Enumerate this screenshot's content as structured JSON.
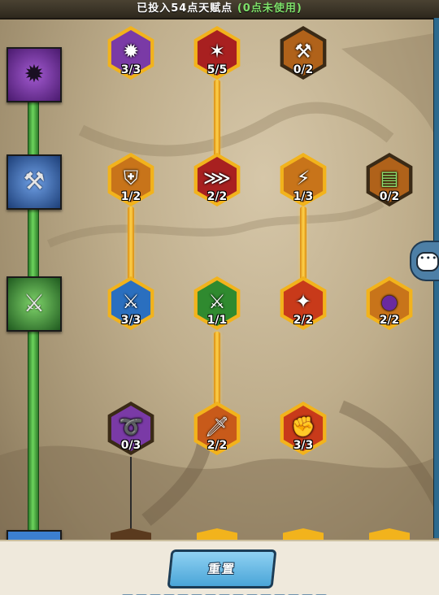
{
  "header": {
    "points_text": "已投入54点天赋点",
    "unused_text": "(0点未使用)"
  },
  "colors": {
    "gold": "#f2b31c",
    "rail_green": "#4fbf3f",
    "button_blue": "#5fb6e4"
  },
  "rows": [
    {
      "icon": "spiked-ball-icon",
      "bg": "#6a2a8f"
    },
    {
      "icon": "axe-icon",
      "bg": "#1f5aa0"
    },
    {
      "icon": "battle-axe-icon",
      "bg": "#2a7a2a"
    },
    {
      "icon": "sword-icon",
      "bg": "#1f5aa0"
    }
  ],
  "nodes": [
    {
      "id": "spiked-ball",
      "level": "3/3",
      "glyph": "✹",
      "inner": "#7a3aa6"
    },
    {
      "id": "blood-claw",
      "level": "5/5",
      "glyph": "✶",
      "inner": "#a82020"
    },
    {
      "id": "hammer",
      "level": "0/2",
      "glyph": "⚒",
      "inner": "#b0621a"
    },
    {
      "id": "helmet",
      "level": "1/2",
      "glyph": "⛨",
      "inner": "#c8741a"
    },
    {
      "id": "claw-slash",
      "level": "2/2",
      "glyph": "⋙",
      "inner": "#a82020"
    },
    {
      "id": "lightning-blade",
      "level": "1/3",
      "glyph": "⚡",
      "inner": "#c8741a"
    },
    {
      "id": "green-book",
      "level": "0/2",
      "glyph": "▤",
      "inner": "#b0621a"
    },
    {
      "id": "ice-axe",
      "level": "3/3",
      "glyph": "⚔",
      "inner": "#2a6fbf"
    },
    {
      "id": "green-axe",
      "level": "1/1",
      "glyph": "⚔",
      "inner": "#2f8a2f"
    },
    {
      "id": "fire-blade",
      "level": "2/2",
      "glyph": "✦",
      "inner": "#c83a1a"
    },
    {
      "id": "purple-orb",
      "level": "2/2",
      "glyph": "●",
      "inner": "#c8741a"
    },
    {
      "id": "purple-whip",
      "level": "0/3",
      "glyph": "➰",
      "inner": "#7a3aa6"
    },
    {
      "id": "golden-sword",
      "level": "2/2",
      "glyph": "🗡",
      "inner": "#c85a1a"
    },
    {
      "id": "fist",
      "level": "3/3",
      "glyph": "✊",
      "inner": "#c83a1a"
    }
  ],
  "footer": {
    "reset_label": "重置"
  }
}
